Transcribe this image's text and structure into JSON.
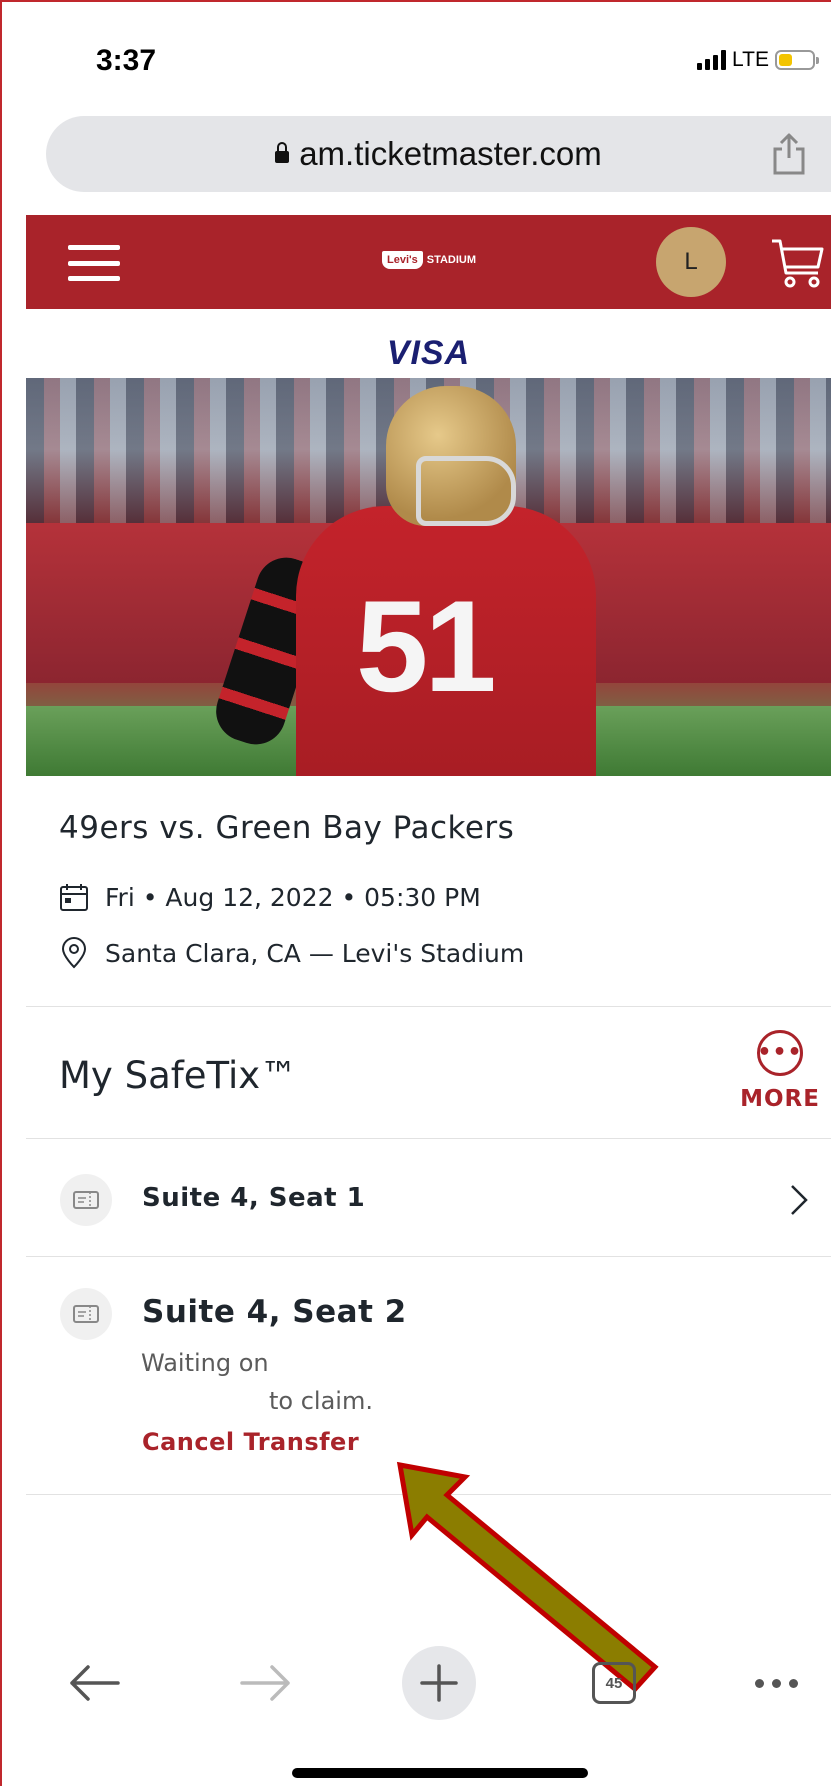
{
  "status_bar": {
    "time": "3:37",
    "network": "LTE"
  },
  "browser": {
    "url": "am.ticketmaster.com",
    "tab_count": "45"
  },
  "site_header": {
    "logo_brand": "Levi's",
    "logo_venue": "STADIUM",
    "avatar_initial": "L"
  },
  "sponsor": {
    "name": "VISA"
  },
  "hero": {
    "jersey_number": "51"
  },
  "event": {
    "title": "49ers vs. Green Bay Packers",
    "date": "Fri • Aug 12, 2022 • 05:30 PM",
    "location": "Santa Clara, CA — Levi's Stadium"
  },
  "safetix": {
    "title": "My SafeTix™",
    "more_label": "MORE",
    "more_dots": "•••",
    "tickets": [
      {
        "label": "Suite 4, Seat 1"
      },
      {
        "label": "Suite 4, Seat 2",
        "status_line1": "Waiting on",
        "status_line2": "to claim.",
        "action": "Cancel Transfer"
      }
    ]
  },
  "colors": {
    "brand_red": "#a9232a",
    "gold": "#c7a56f",
    "visa_blue": "#1a1f71",
    "annotation_arrow_fill": "#8b7d00",
    "annotation_arrow_stroke": "#c00000"
  },
  "icons": {
    "menu": "hamburger-icon",
    "cart": "cart-icon",
    "share": "share-icon",
    "lock": "lock-icon",
    "calendar": "calendar-icon",
    "location": "location-pin-icon",
    "ticket": "ticket-icon",
    "chevron": "chevron-right-icon",
    "back": "arrow-left-icon",
    "forward": "arrow-right-icon",
    "new_tab": "plus-icon",
    "tabs": "tabs-icon",
    "overflow": "more-dots-icon"
  }
}
